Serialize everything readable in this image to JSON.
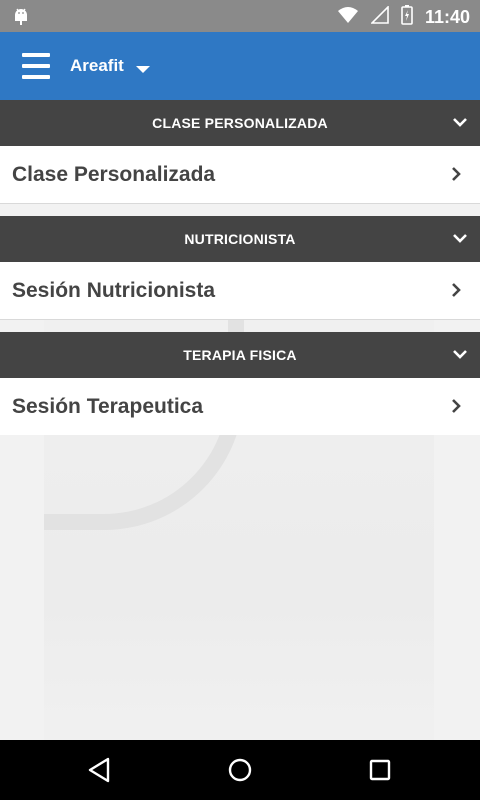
{
  "status_bar": {
    "time": "11:40",
    "icons": [
      "android-icon",
      "wifi-icon",
      "signal-icon",
      "battery-icon"
    ]
  },
  "app_bar": {
    "title": "Areafit",
    "color": "#2f78c4"
  },
  "sections": [
    {
      "header": "CLASE PERSONALIZADA",
      "items": [
        {
          "label": "Clase Personalizada"
        }
      ]
    },
    {
      "header": "NUTRICIONISTA",
      "items": [
        {
          "label": "Sesión Nutricionista"
        }
      ]
    },
    {
      "header": "TERAPIA FISICA",
      "items": [
        {
          "label": "Sesión Terapeutica"
        }
      ]
    }
  ],
  "nav_bar": {
    "buttons": [
      "back-icon",
      "home-icon",
      "recents-icon"
    ]
  }
}
